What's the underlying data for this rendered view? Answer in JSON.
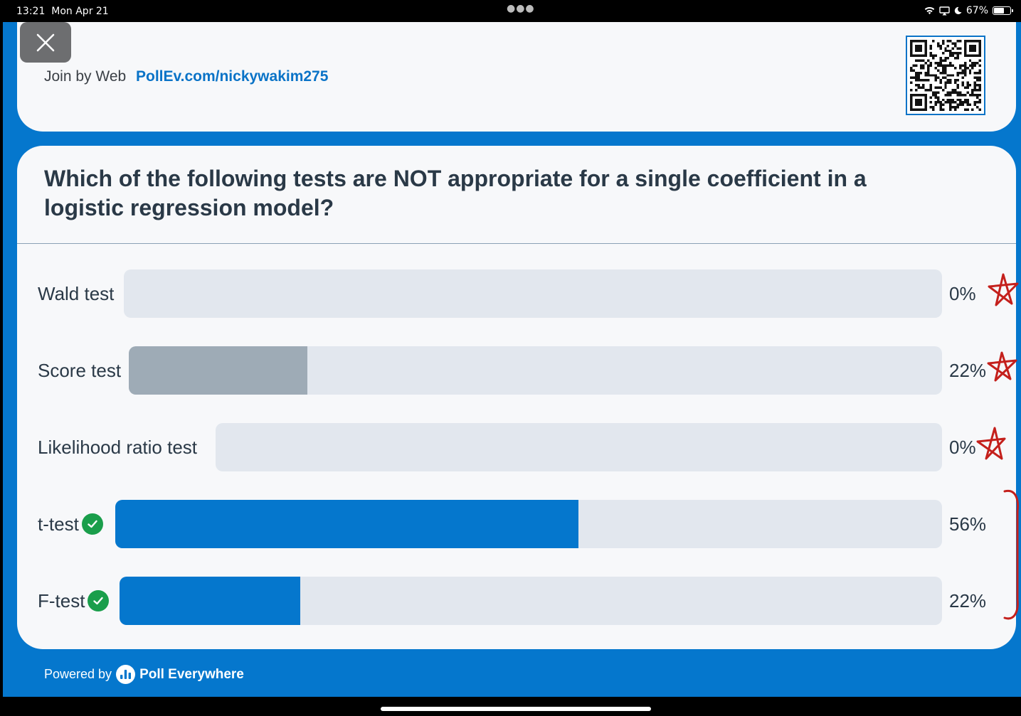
{
  "status_bar": {
    "time": "13:21",
    "date": "Mon Apr 21",
    "battery": "67%",
    "battery_level": 0.67
  },
  "join": {
    "label": "Join by Web",
    "url": "PollEv.com/nickywakim275"
  },
  "question": "Which of the following tests are NOT appropriate for a single coefficient in a logistic regression model?",
  "options": [
    {
      "label": "Wald test",
      "percent_text": "0%",
      "value": 0,
      "correct": false,
      "bar_color": "#9eabb6"
    },
    {
      "label": "Score test",
      "percent_text": "22%",
      "value": 22,
      "correct": false,
      "bar_color": "#9eabb6"
    },
    {
      "label": "Likelihood ratio test",
      "percent_text": "0%",
      "value": 0,
      "correct": false,
      "bar_color": "#9eabb6"
    },
    {
      "label": "t-test",
      "percent_text": "56%",
      "value": 56,
      "correct": true,
      "bar_color": "#0577cd"
    },
    {
      "label": "F-test",
      "percent_text": "22%",
      "value": 22,
      "correct": true,
      "bar_color": "#0577cd"
    }
  ],
  "chart_data": {
    "type": "bar",
    "categories": [
      "Wald test",
      "Score test",
      "Likelihood ratio test",
      "t-test",
      "F-test"
    ],
    "values": [
      0,
      22,
      0,
      56,
      22
    ]
  },
  "footer": {
    "powered_by": "Powered by",
    "brand": "Poll Everywhere"
  },
  "colors": {
    "brand_blue": "#0577cd",
    "track": "#e2e7ee",
    "incorrect_fill": "#9eabb6",
    "correct_check": "#1a9e4b",
    "annotation_red": "#c4201c"
  },
  "icons": {
    "close": "close-icon",
    "qr": "qr-code-icon",
    "check": "check-circle-icon",
    "logo": "poll-everywhere-logo-icon"
  }
}
